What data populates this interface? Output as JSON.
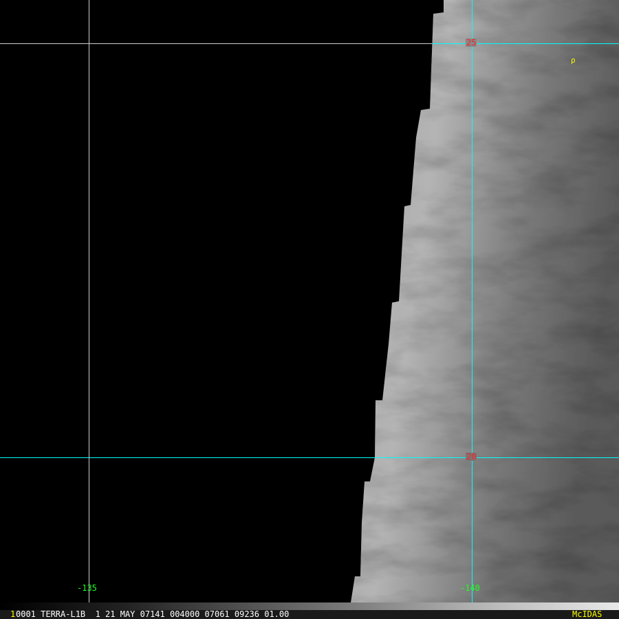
{
  "frame_number": "1",
  "status_line": "0001 TERRA-L1B  1 21 MAY 07141 004000 07061 09236 01.00",
  "brand": "McIDAS",
  "grid_labels": {
    "lat_25": "25",
    "lat_20": "20",
    "lon_135": "-135",
    "lon_140": "-140"
  },
  "marker_glyph": "ρ",
  "colors": {
    "lat_label": "#ff2020",
    "lon_label": "#20ff20",
    "grid_cyan": "#00ffff",
    "grid_white": "#d0d0d0",
    "brand": "#ffff00"
  }
}
